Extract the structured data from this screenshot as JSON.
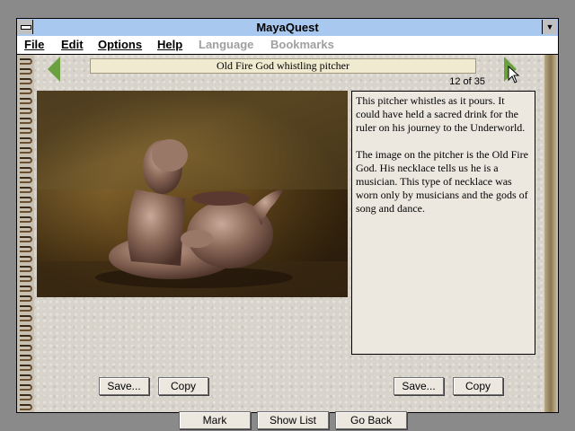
{
  "window": {
    "title": "MayaQuest"
  },
  "menubar": {
    "items": [
      {
        "label": "File",
        "enabled": true
      },
      {
        "label": "Edit",
        "enabled": true
      },
      {
        "label": "Options",
        "enabled": true
      },
      {
        "label": "Help",
        "enabled": true
      },
      {
        "label": "Language",
        "enabled": false
      },
      {
        "label": "Bookmarks",
        "enabled": false
      }
    ]
  },
  "page": {
    "caption": "Old Fire God whistling pitcher",
    "counter": "12 of 35",
    "description": [
      "This pitcher whistles as it pours. It could have held a sacred drink for the ruler on his journey to the Underworld.",
      "The image on the pitcher is the Old Fire God. His necklace tells us he is a musician. This type of necklace was worn only by musicians and the gods of song and dance."
    ]
  },
  "buttons": {
    "image_save": "Save...",
    "image_copy": "Copy",
    "text_save": "Save...",
    "text_copy": "Copy",
    "mark": "Mark",
    "show_list": "Show List",
    "go_back": "Go Back"
  },
  "colors": {
    "titlebar": "#a8c8f0",
    "nav_arrow": "#6aa040",
    "caption_bg": "#f0ead0"
  }
}
